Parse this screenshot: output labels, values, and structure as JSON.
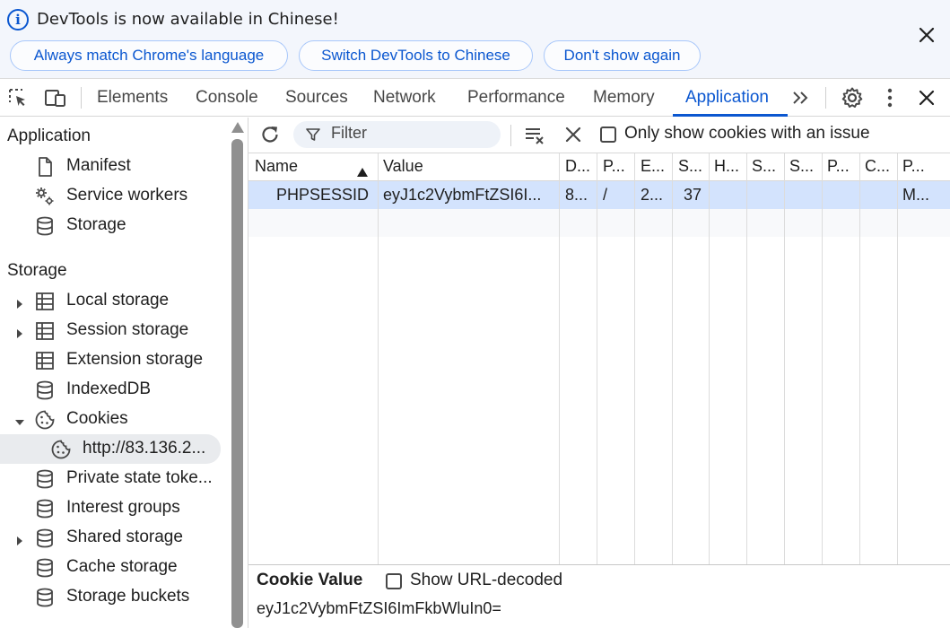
{
  "infobar": {
    "message": "DevTools is now available in Chinese!",
    "buttons": [
      "Always match Chrome's language",
      "Switch DevTools to Chinese",
      "Don't show again"
    ],
    "info_icon": "info-icon",
    "close_icon": "close-icon"
  },
  "toolbar": {
    "tabs": [
      "Elements",
      "Console",
      "Sources",
      "Network",
      "Performance",
      "Memory",
      "Application"
    ],
    "active_tab": "Application",
    "icons": [
      "inspect-element-icon",
      "device-toolbar-icon",
      "more-tabs-icon",
      "settings-icon",
      "more-options-icon",
      "close-devtools-icon"
    ]
  },
  "sidebar": {
    "application_heading": "Application",
    "application_items": [
      {
        "label": "Manifest",
        "icon": "document-icon"
      },
      {
        "label": "Service workers",
        "icon": "gears-icon"
      },
      {
        "label": "Storage",
        "icon": "database-icon"
      }
    ],
    "storage_heading": "Storage",
    "storage_items": [
      {
        "label": "Local storage",
        "icon": "table-icon",
        "expandable": true
      },
      {
        "label": "Session storage",
        "icon": "table-icon",
        "expandable": true
      },
      {
        "label": "Extension storage",
        "icon": "table-icon",
        "expandable": false
      },
      {
        "label": "IndexedDB",
        "icon": "database-icon",
        "expandable": false
      },
      {
        "label": "Cookies",
        "icon": "cookie-icon",
        "expanded": true
      },
      {
        "label": "http://83.136.2...",
        "icon": "cookie-icon",
        "selected": true
      },
      {
        "label": "Private state toke...",
        "icon": "database-icon",
        "expandable": false
      },
      {
        "label": "Interest groups",
        "icon": "database-icon",
        "expandable": false
      },
      {
        "label": "Shared storage",
        "icon": "database-icon",
        "expandable": true
      },
      {
        "label": "Cache storage",
        "icon": "database-icon",
        "expandable": false
      },
      {
        "label": "Storage buckets",
        "icon": "database-icon",
        "expandable": false
      }
    ]
  },
  "cookie_toolbar": {
    "filter_placeholder": "Filter",
    "only_issues_label": "Only show cookies with an issue",
    "only_issues_checked": false,
    "icons": [
      "refresh-icon",
      "filter-icon",
      "clear-all-icon",
      "delete-selected-icon"
    ]
  },
  "cookie_table": {
    "columns": [
      "Name",
      "Value",
      "D...",
      "P...",
      "E...",
      "S...",
      "H...",
      "S...",
      "S...",
      "P...",
      "C...",
      "P..."
    ],
    "sort_column": "Name",
    "sort_direction": "ascending",
    "rows": [
      [
        "PHPSESSID",
        "eyJ1c2VybmFtZSI6I...",
        "8...",
        "/",
        "2...",
        "37",
        "",
        "",
        "",
        "",
        "",
        "M..."
      ]
    ]
  },
  "cookie_value": {
    "title": "Cookie Value",
    "show_decoded_label": "Show URL-decoded",
    "show_decoded_checked": false,
    "value": "eyJ1c2VybmFtZSI6ImFkbWluIn0="
  },
  "colors": {
    "accent": "#0b57d0",
    "selected_row": "#d3e3fd",
    "infobar_bg": "#f3f6fc"
  }
}
